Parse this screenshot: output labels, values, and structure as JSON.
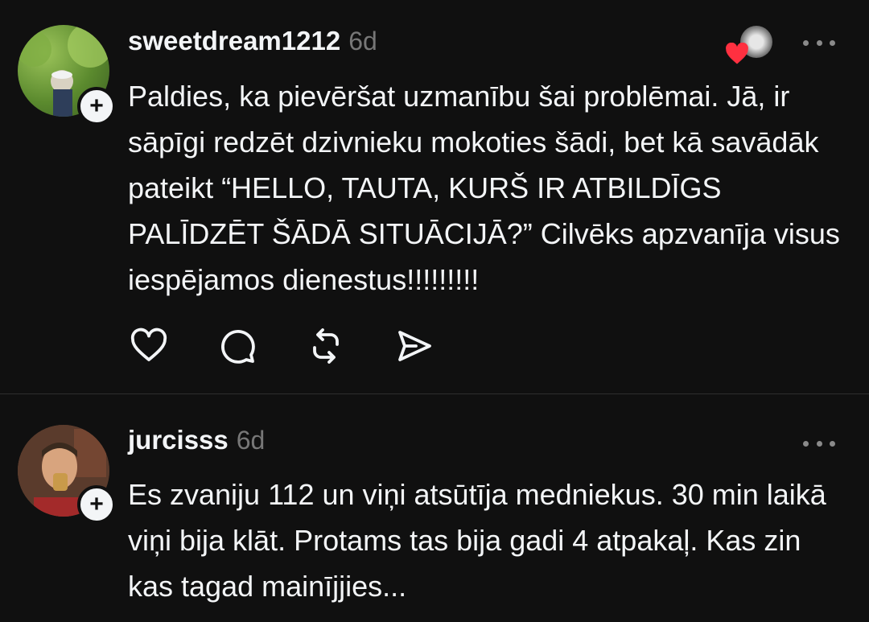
{
  "posts": [
    {
      "username": "sweetdream1212",
      "time": "6d",
      "text": "Paldies, ka pievēršat uzmanību šai problēmai. Jā, ir sāpīgi redzēt dzivnieku mokoties šādi, bet kā savādāk pateikt “HELLO, TAUTA, KURŠ IR ATBILDĪGS PALĪDZĒT ŠĀDĀ SITUĀCIJĀ?” Cilvēks apzvanīja visus iespējamos dienestus!!!!!!!!!",
      "follow_symbol": "+",
      "actions": [
        "heart-icon",
        "comment-icon",
        "repost-icon",
        "share-icon"
      ]
    },
    {
      "username": "jurcisss",
      "time": "6d",
      "text": "Es zvaniju 112 un viņi atsūtīja medniekus. 30 min laikā viņi bija klāt. Protams tas bija gadi 4 atpakaļ. Kas zin kas tagad mainījjies...",
      "follow_symbol": "+"
    }
  ],
  "colors": {
    "background": "#101010",
    "text": "#f3f5f7",
    "muted": "#777777",
    "heart": "#ff3040"
  }
}
